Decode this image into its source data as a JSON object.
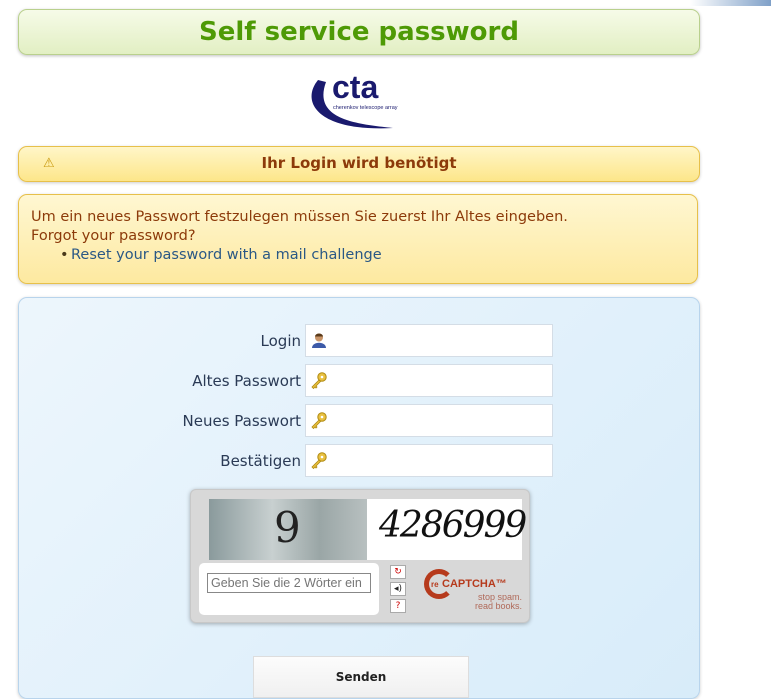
{
  "header": {
    "title": "Self service password"
  },
  "logo": {
    "name": "cta",
    "subtitle": "cherenkov telescope array"
  },
  "warning": {
    "icon": "warning-icon",
    "text": "Ihr Login wird benötigt"
  },
  "info": {
    "line1": "Um ein neues Passwort festzulegen müssen Sie zuerst Ihr Altes eingeben.",
    "line2": "Forgot your password?",
    "link": "Reset your password with a mail challenge"
  },
  "form": {
    "login_label": "Login",
    "old_label": "Altes Passwort",
    "new_label": "Neues Passwort",
    "confirm_label": "Bestätigen",
    "login_icon": "user-icon",
    "key_icon": "key-icon",
    "submit": "Senden"
  },
  "captcha": {
    "word1": "9",
    "word2": "4286999",
    "placeholder": "Geben Sie die 2 Wörter ein",
    "brand_prefix": "re",
    "brand": "CAPTCHA™",
    "tagline1": "stop spam.",
    "tagline2": "read books."
  }
}
